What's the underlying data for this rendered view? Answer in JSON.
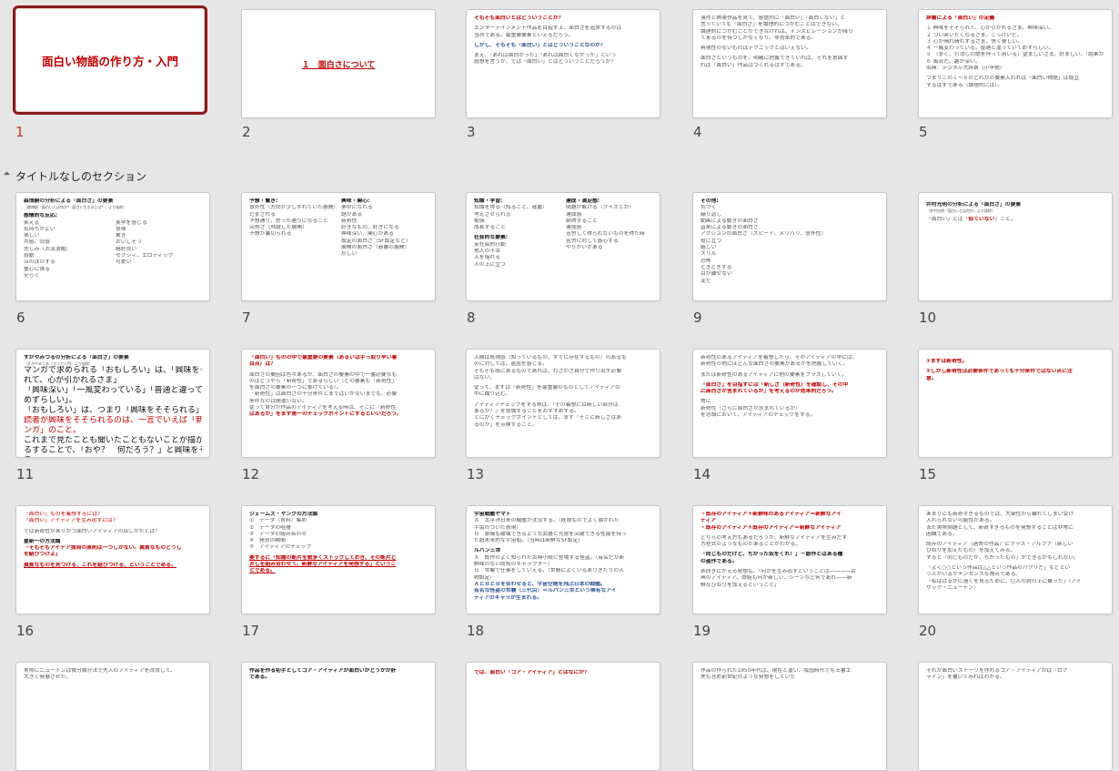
{
  "section_title": "タイトルなしのセクション",
  "colors": {
    "selected_border": "#8b1a1a",
    "accent_red": "#c00000",
    "accent_blue": "#2f5597"
  },
  "slides": [
    {
      "number": "1",
      "title": "面白い物語の作り方・入門"
    },
    {
      "number": "2",
      "link": "１　面白さについて"
    },
    {
      "number": "3",
      "lines": [
        "そもそも面白いとはどういうことか？",
        "",
        "エンターテインメント作品を目指す上、面白さを追求するのは",
        "当然である。最重要要素といえるだろう。",
        "",
        "しかし、そもそも「面白い」とはどういうことなのか？",
        "",
        "まえ、「あれは面白かった」「あれは面白くなかった」という",
        "感想を言うが、では「面白い」とはどういうことだろうか？"
      ]
    },
    {
      "number": "4",
      "lines": [
        "漠然と娯楽作品を見て、感覚的に「面白い」「面白くない」と",
        "言っていても「面白さ」を論理的につかむことはできない。",
        "論理的につかむことができなければ、インスピレーションが降り",
        "て来るのを待つしかなくなり、非効率的である。",
        "",
        "再現性のないものはテクニックとはいえない。",
        "",
        "面白さというものを、明確に把握できていれば、それを意図す",
        "れば「面白い」作品はつくれるはずである。"
      ]
    },
    {
      "number": "5",
      "lines": [
        "辞書による「面白い」の定義",
        "",
        "１ 興味をそそられて、心が引かれるさま。興味深い。",
        "２ つい笑いたくなるさま。こっけいだ。",
        "３ 心が晴れ晴れするさま。快く楽しい。",
        "４ 一風変わっている。普通と違っていてめずらしい。",
        "５ （多く、打消しの語を伴って用いる）望ましいさま。好ましい。「結果が……くない」",
        "６ 風流だ。趣が深い。",
        "出典：デジタル大辞泉（小学館）",
        "",
        "つまりこの１～６のどれかの要素入れれば「面白い物語」は成立",
        "するはずである（論理的には）。"
      ]
    },
    {
      "number": "6",
      "title": "森博嗣の分析による「面白さ」の要素",
      "sub": "（森博嗣『面白いとは何か？ 面白く生きるには？』より抜粋）",
      "heading": "感情的な反応:",
      "col1": [
        "笑える",
        "気持ちがよい",
        "楽しい",
        "共感、同感",
        "悲しみ（お涙頂戴）",
        "感動",
        "ほのぼのする",
        "童心に帰る",
        "安らぐ"
      ],
      "col2": [
        "美学を感じる",
        "意味",
        "驚き",
        "おいしそう",
        "格好良い",
        "セクシィ、エロティック",
        "可愛い"
      ]
    },
    {
      "number": "7",
      "col1_heading": "予想・驚き:",
      "col1": [
        "意外性（方向が少しずれていた展開）",
        "だまされる",
        "予想通り、思った通りになること",
        "突飛さ（飛躍した展開）",
        "予想が裏切られる"
      ],
      "col2_heading": "興味・関心:",
      "col2": [
        "夢中になれる",
        "謎がある",
        "新奇性",
        "好きなもの、好きになる",
        "興味深い、関心がある",
        "設定の面白さ（SF設定など）",
        "展開の面白さ（筋書の展開）",
        "珍しい"
      ]
    },
    {
      "number": "8",
      "col1_heading": "知識・学習:",
      "col1": [
        "知識を得る（知ること、蘊蓄）",
        "考えさせられる",
        "勉強",
        "成長すること"
      ],
      "col1_heading2": "社会的な要素:",
      "col1b": [
        "反社会的行動",
        "他人の不幸",
        "人を陥れる",
        "人の上に立つ"
      ],
      "col2_heading": "達成・満足感:",
      "col2": [
        "問題が解ける（クイズとか）",
        "達成感",
        "納得すること",
        "達成感",
        "苦労して得られないものを得た時",
        "苦労に対して感心する",
        "やりがいがある"
      ]
    },
    {
      "number": "9",
      "heading": "その他:",
      "lines": [
        "気づく",
        "繰り返し",
        "動画による動きの面白さ",
        "音楽による動きの面白さ",
        "アクションの面白さ（スピード、メリハリ、意外性）",
        "役に立つ",
        "嬉しい",
        "スリル",
        "恐怖",
        "どきどきする",
        "目が離せない",
        "変だ"
      ]
    },
    {
      "number": "10",
      "title": "井村光明の分析による「面白さ」の要素",
      "sub": "（井村光明『面白いとは何か』より抜粋）",
      "line_before": "「面白い」とは「",
      "highlight": "似ていない",
      "line_after": "」こと。"
    },
    {
      "number": "11",
      "title": "すがやみつるの分析による「面白さ」の要素",
      "sub": "（すがやみつる『マンガ入門』より抜粋）",
      "lines": [
        "マンガで求められる「おもしろい」は、「興味をそそら",
        "れて、心が引かれるさま」",
        "「興味深い」「一風変わっている」「普通と違っていて",
        "めずらしい」。",
        "「おもしろい」は、つまり「興味をそそられる」こと。",
        "読者が興味をそそられるのは、一言でいえば「新鮮なマ",
        "ンガ」のこと。",
        "これまで見たことも聞いたこともないことが描かれてい",
        "るすることで、「おや？　何だろう？」と興味をそそられ",
        "る。"
      ]
    },
    {
      "number": "12",
      "lines": [
        "「面白い」ものの中で最重要の要素（あるいは手っ取り早い着",
        "目点）は？",
        "",
        "面白さの要因は色々あるが、面白さの要素の中で一番必要なも",
        "のはどうやら「新奇性」であるらしい（どの要素も「新奇性」",
        "を面白さの要素の一つに挙げている）。",
        "「新奇性」は面白さの十分条件とまではいかないまでも、必要",
        "条件なのは間違いない。",
        "従って自分が作品のアイディアを考える時は、そこに「新奇性",
        "はあるか」をまず第一のチェックポイントにするといいだろう。"
      ]
    },
    {
      "number": "13",
      "lines": [
        "人間は既視感（知っているもの、すでに存在するもの）のあるも",
        "のに対しては、退屈を感じる。",
        "そもそも既にあるものであれば、わざわざ自分で作り出す必要",
        "はない。",
        "",
        "従って、まずは「新奇性」を最重要のものとしてアイディアの",
        "中に織り込む。",
        "",
        "アイディアチェックをする際は、「その着想に目新しい部分は",
        "あるか？」を意識することをおすすめする。",
        "とにかくチェックポイントとしては、まず「そこに新しさはあ",
        "るのか」を点検すること。"
      ]
    },
    {
      "number": "14",
      "lines": [
        "新奇性のあるアイディアを着想したら、そのアイディアの中には、",
        "新奇性の他にほどんな面白さの要素があるかを把握していく。",
        "",
        "または新奇性のあるアイディアに他の要素をプラスしていく。",
        "",
        "「面白さ」を目指すには「新しさ（新奇性）を確認し、その中",
        "に面白さが含まれているか」を考えるのが効率的だろう。",
        "",
        "常に",
        "新奇性（さらに面白さが含まれているか）",
        "を念頭において、アイディアのチェックをする。"
      ]
    },
    {
      "number": "15",
      "lines": [
        "①まずは新奇性。",
        "",
        "②しかし新奇性は必要条件であっても十分条件ではない点に注",
        "意。"
      ]
    },
    {
      "number": "16",
      "lines": [
        "「面白い」ものを着想するには？",
        "「面白い」アイディアを生み出すには？",
        "",
        "では新奇性がありかつ面白いアイディアの出しかたとは？",
        "",
        "星新一の方法論",
        "「そもそもアイデア独自の原則は一つしかない。異質なものどうし",
        "を結びつけよ」",
        "",
        "異質なものを見つける、これを結びつける、ということである。"
      ]
    },
    {
      "number": "17",
      "title": "ジェームズ・ヤングの方法論",
      "lines": [
        "①　データ（資料）集め",
        "②　データの咀嚼",
        "③　データの組み合わせ",
        "④　発見の瞬間",
        "⑤　アイディアのチェック",
        "",
        "要するに「知識の断片を数多くストックしておき、その断片ど",
        "おしを組み合わせて、新鮮なアイディアを発想する」というこ",
        "とである。"
      ]
    },
    {
      "number": "18",
      "lines": [
        "宇宙戦艦ヤマト",
        "Ａ　太平洋日米の戦艦が沈没する。（既視ものでよく描かれた",
        "手垢のついた表現）",
        "Ｂ　原爆も破壊できるような武器と光速を突破できる性能を持っ",
        "た超未来的な宇宙船。（当時は新鮮なSF設定）",
        "",
        "ルパン三世",
        "Ａ　既作のよく知られた古典小説に登場する怪盗。（有名だが新",
        "鮮味のない既知のキャラクター）",
        "Ｂ　世襲で仕事をしていえる。（世間によくいるありきたりの人",
        "物設定）",
        "ＡとＢとＢを合わせると、宇宙空間を飛ぶ日本の戦艦。",
        "有名な怪盗の世襲（三代目）＝ルパン三世という稀有なアイ",
        "ディアのキャラが生まれる。"
      ]
    },
    {
      "number": "19",
      "lines": [
        "・既存のアイディア＋新鮮味のあるアイディア＝新鮮なアイ",
        "ディア",
        "・既存のアイディア＋既存のアイディア＝新鮮なアイディア",
        "",
        "どちらの考え方もあるだろうが、新鮮なアイディアを生みだす",
        "方程式のようなものがあることがわかる。",
        "",
        "「同じものだけど、ちがった奴をくれ！」－創作とはある種",
        "の盗作である。",
        "",
        "表向きにかえる発想も、「何かを生み出すということは――――古",
        "典のアイディア、骨組も何か新しい、シーンなど何であれ――新",
        "鮮なひねりを加えるということ」"
      ]
    },
    {
      "number": "20",
      "lines": [
        "あまりにも新奇すぎるものでは、大衆性から離れてしまい受け",
        "入れられない可能性がある。",
        "また実際問題として、新奇すぎるものを発想することは非常に",
        "困難である。",
        "",
        "既存のアイディア（過去の作品）にプラス・アルファ（新しい",
        "ひねりを加えたもの）を加えてみる。",
        "すると「同じものだが、ちがったもの」ができるかもしれない。",
        "",
        "「よく○○という作品は△△という作品のパクリだ」などとい",
        "う人がいるがナンセンスな視点である。",
        "「私ははるかに遠くを見るために、巨人の肩の上に乗った」（アイ",
        "ザック・ニュートン）"
      ]
    },
    {
      "lines": [
        "実際にニュートンは微分積分法で先人のアイディアを改良して、",
        "大きく発展させた。"
      ]
    },
    {
      "lines": [
        "作品を作る初手としてコア・アイディアが面白いかどうかが肝",
        "である。"
      ]
    },
    {
      "lines": [
        "では、面白い「コア・アイディア」とはなにか？"
      ]
    },
    {
      "lines": [
        "作品の作られた1950年代は、現在と違い、我国時代でも士書エ",
        "夫も含め前世紀のような発想をしていた"
      ]
    },
    {
      "lines": [
        "それが面白いストーリを作れるコア・アイディアかは「ログ",
        "ライン」を書いてみればわかる。"
      ]
    }
  ]
}
